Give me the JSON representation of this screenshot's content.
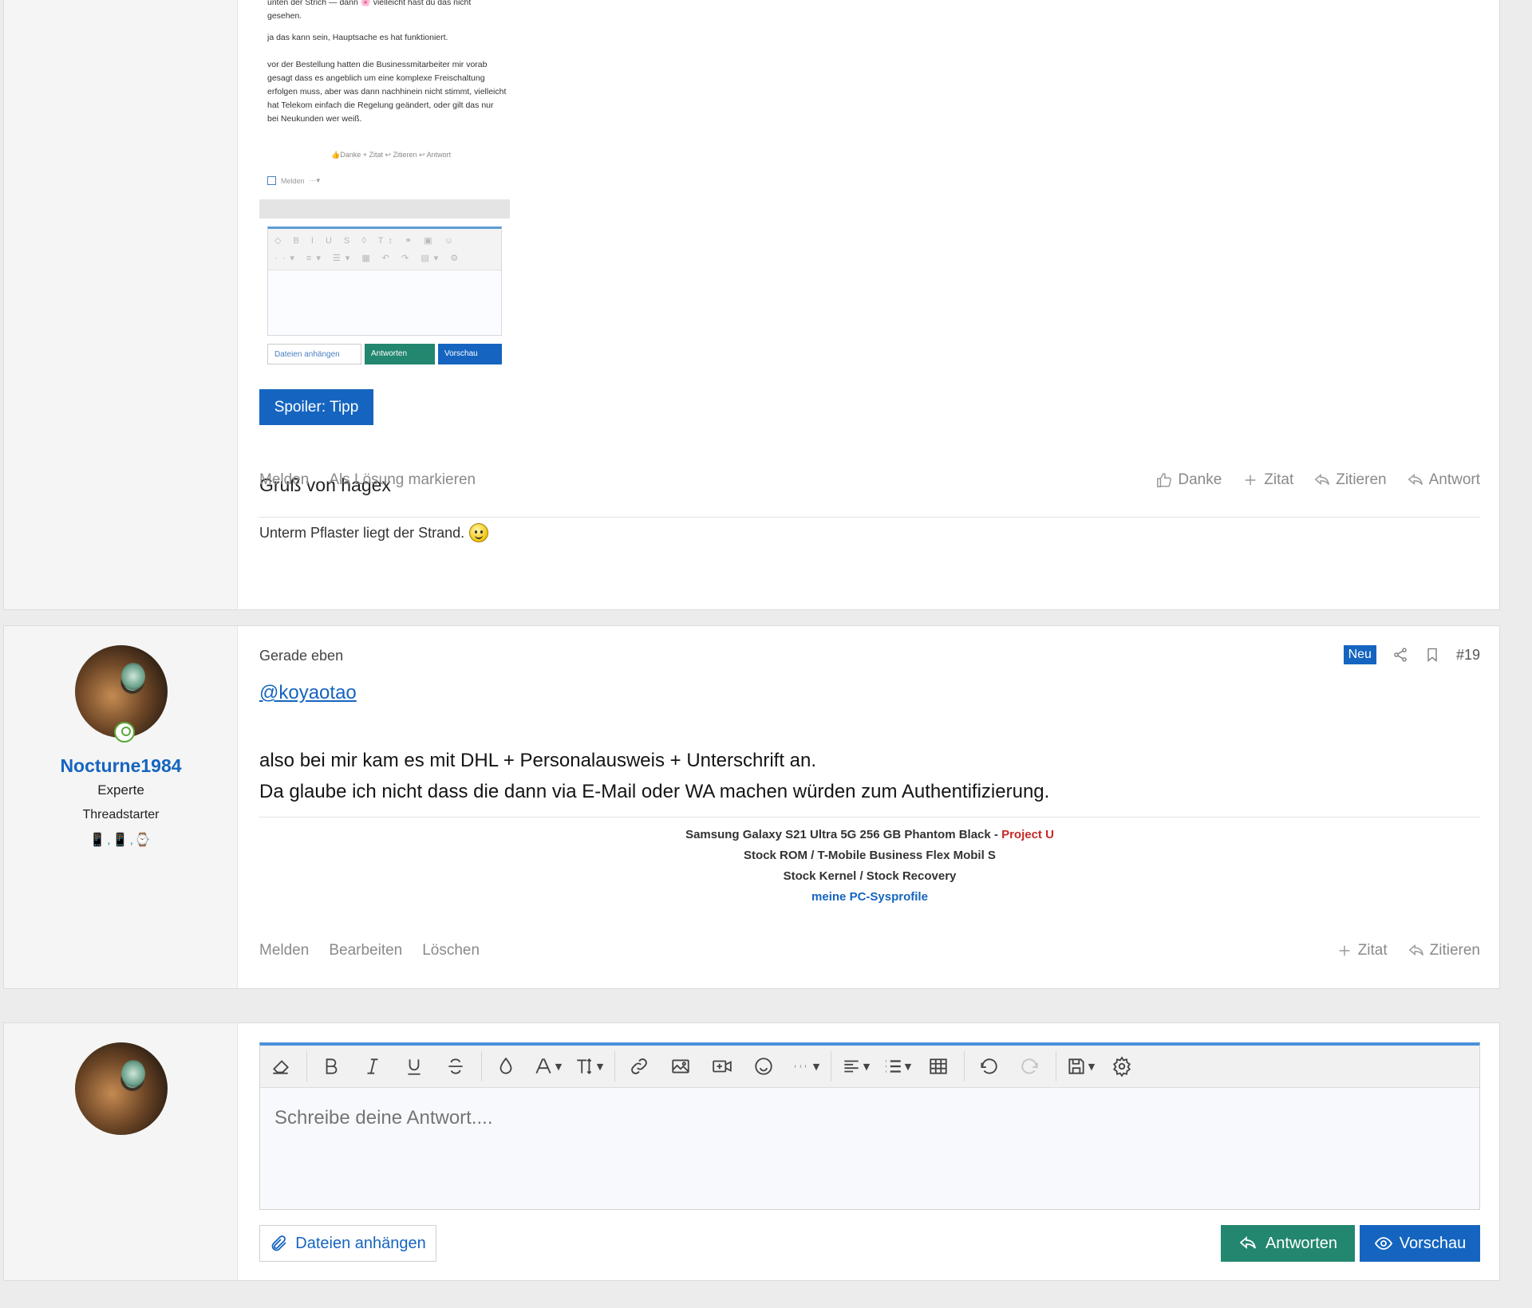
{
  "post1": {
    "screenshot": {
      "line_top": "unten der Strich — dann 🌸 vielleicht hast du das nicht gesehen.",
      "para1": "ja das kann sein, Hauptsache es hat funktioniert.",
      "para2": "vor der Bestellung hatten die Businessmitarbeiter mir vorab gesagt dass es angeblich um eine komplexe Freischaltung erfolgen muss, aber was dann nachhinein nicht stimmt, vielleicht hat Telekom einfach die Regelung geändert, oder gilt das nur bei Neukunden wer weiß.",
      "mini_actions": "👍Danke  + Zitat  ↩ Zitieren  ↩ Antwort",
      "mini_report": "Melden",
      "mini_report_more": "···▾",
      "mini_toolbar_row1": "◇ B I U S ◊ T↕ ⚭ ▣ ☺",
      "mini_toolbar_row2": "··▾ ≡▾ ☰▾ ▦ ↶ ↷ ▤▾ ⚙",
      "mini_attach": "Dateien anhängen",
      "mini_answer": "Antworten",
      "mini_preview": "Vorschau"
    },
    "spoiler_label": "Spoiler: Tipp",
    "greeting": "Gruß von hagex",
    "signature": "Unterm Pflaster liegt der Strand.",
    "actions_left": [
      "Melden",
      "Als Lösung markieren"
    ],
    "actions_right": [
      "Danke",
      "Zitat",
      "Zitieren",
      "Antwort"
    ]
  },
  "post2": {
    "author": {
      "name": "Nocturne1984",
      "title": "Experte",
      "badge": "Threadstarter",
      "devices": "📱,📱,⌚"
    },
    "date": "Gerade eben",
    "new_badge": "Neu",
    "post_number": "#19",
    "mention": "@koyaotao",
    "lines": [
      "also bei mir kam es mit DHL + Personalausweis + Unterschrift an.",
      "Da glaube ich nicht dass die dann via E-Mail oder WA machen würden zum Authentifizierung."
    ],
    "signature": {
      "line1": "Samsung Galaxy S21 Ultra 5G 256 GB Phantom Black - ",
      "line1_red": "Project U",
      "line2": "Stock ROM / T-Mobile Business Flex Mobil S",
      "line3": "Stock Kernel / Stock Recovery",
      "line4": "meine PC-Sysprofile"
    },
    "actions_left": [
      "Melden",
      "Bearbeiten",
      "Löschen"
    ],
    "actions_right": [
      "Zitat",
      "Zitieren"
    ]
  },
  "reply": {
    "placeholder": "Schreibe deine Antwort....",
    "attach_label": "Dateien anhängen",
    "answer_label": "Antworten",
    "preview_label": "Vorschau"
  },
  "colors": {
    "accent": "#1565c0",
    "answer_green": "#23866f",
    "new_badge": "#1565c0",
    "signature_red": "#c62828"
  }
}
